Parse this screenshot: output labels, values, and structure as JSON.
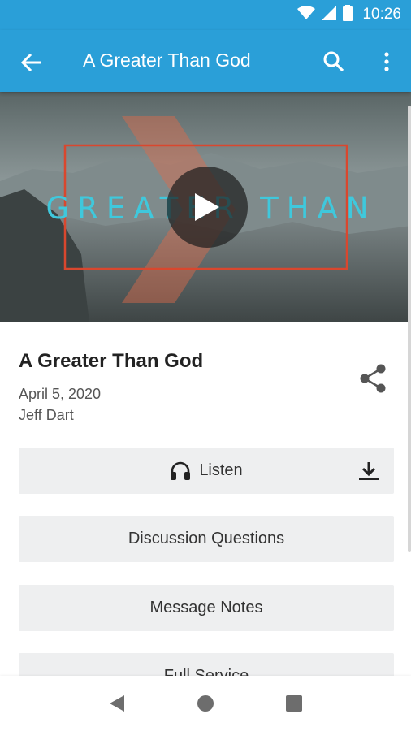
{
  "status_bar": {
    "time": "10:26"
  },
  "app_bar": {
    "title": "A Greater Than God"
  },
  "hero": {
    "title_text": "GREATER THAN"
  },
  "sermon": {
    "title": "A Greater Than God",
    "date": "April 5, 2020",
    "speaker": "Jeff Dart"
  },
  "actions": {
    "listen_label": "Listen",
    "discussion_label": "Discussion Questions",
    "notes_label": "Message Notes",
    "full_service_label": "Full Service"
  },
  "colors": {
    "primary": "#2a9fd8",
    "hero_text": "#3fc8dc",
    "button_bg": "#eeeff0"
  }
}
